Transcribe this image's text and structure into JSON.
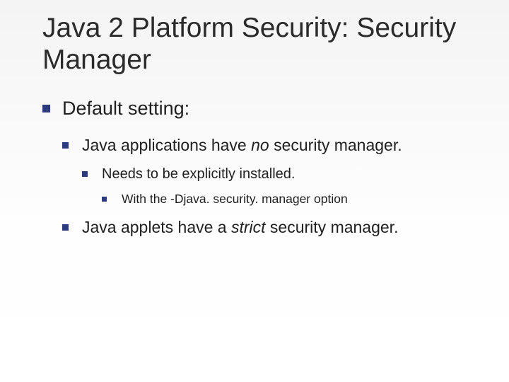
{
  "title": "Java 2 Platform Security: Security Manager",
  "l1": "Default setting:",
  "l2a_pre": "Java applications have ",
  "l2a_em": "no",
  "l2a_post": " security manager.",
  "l3": "Needs to be explicitly installed.",
  "l4": "With the -Djava. security. manager option",
  "l2b_pre": "Java applets have a ",
  "l2b_em": "strict",
  "l2b_post": " security manager."
}
